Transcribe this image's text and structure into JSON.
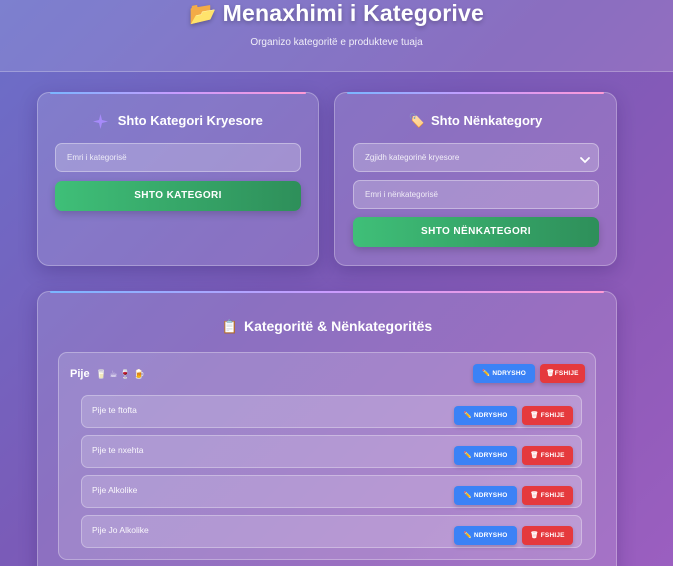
{
  "header": {
    "icon": "folder-icon",
    "title": "Menaxhimi i Kategorive",
    "subtitle": "Organizo kategoritë e produkteve tuaja"
  },
  "main_category_form": {
    "icon": "sparkle-icon",
    "title": "Shto Kategori Kryesore",
    "name_placeholder": "Emri i kategorisë",
    "submit_label": "SHTO KATEGORI"
  },
  "subcategory_form": {
    "icon": "tag-icon",
    "title": "Shto Nënkategory",
    "parent_select_value": "Zgjidh kategorinë kryesore",
    "name_placeholder": "Emri i nënkategorisë",
    "submit_label": "SHTO NËNKATEGORI"
  },
  "list": {
    "icon": "clipboard-icon",
    "title": "Kategoritë & Nënkategoritës",
    "categories": [
      {
        "name": "Pije",
        "emoji": "🥛 ☕ 🍷 🍺",
        "edit_label": "NDRYSHO",
        "delete_label": "FSHIJE",
        "subcategories": [
          {
            "name": "Pije te ftofta",
            "edit_label": "NDRYSHO",
            "delete_label": "FSHIJE"
          },
          {
            "name": "Pije te nxehta",
            "edit_label": "NDRYSHO",
            "delete_label": "FSHIJE"
          },
          {
            "name": "Pije Alkolike",
            "edit_label": "NDRYSHO",
            "delete_label": "FSHIJE"
          },
          {
            "name": "Pije Jo Alkolike",
            "edit_label": "NDRYSHO",
            "delete_label": "FSHIJE"
          }
        ]
      }
    ]
  },
  "colors": {
    "green_button": "#3fbf78",
    "edit_button": "#3b82f6",
    "delete_button": "#e5393d"
  }
}
